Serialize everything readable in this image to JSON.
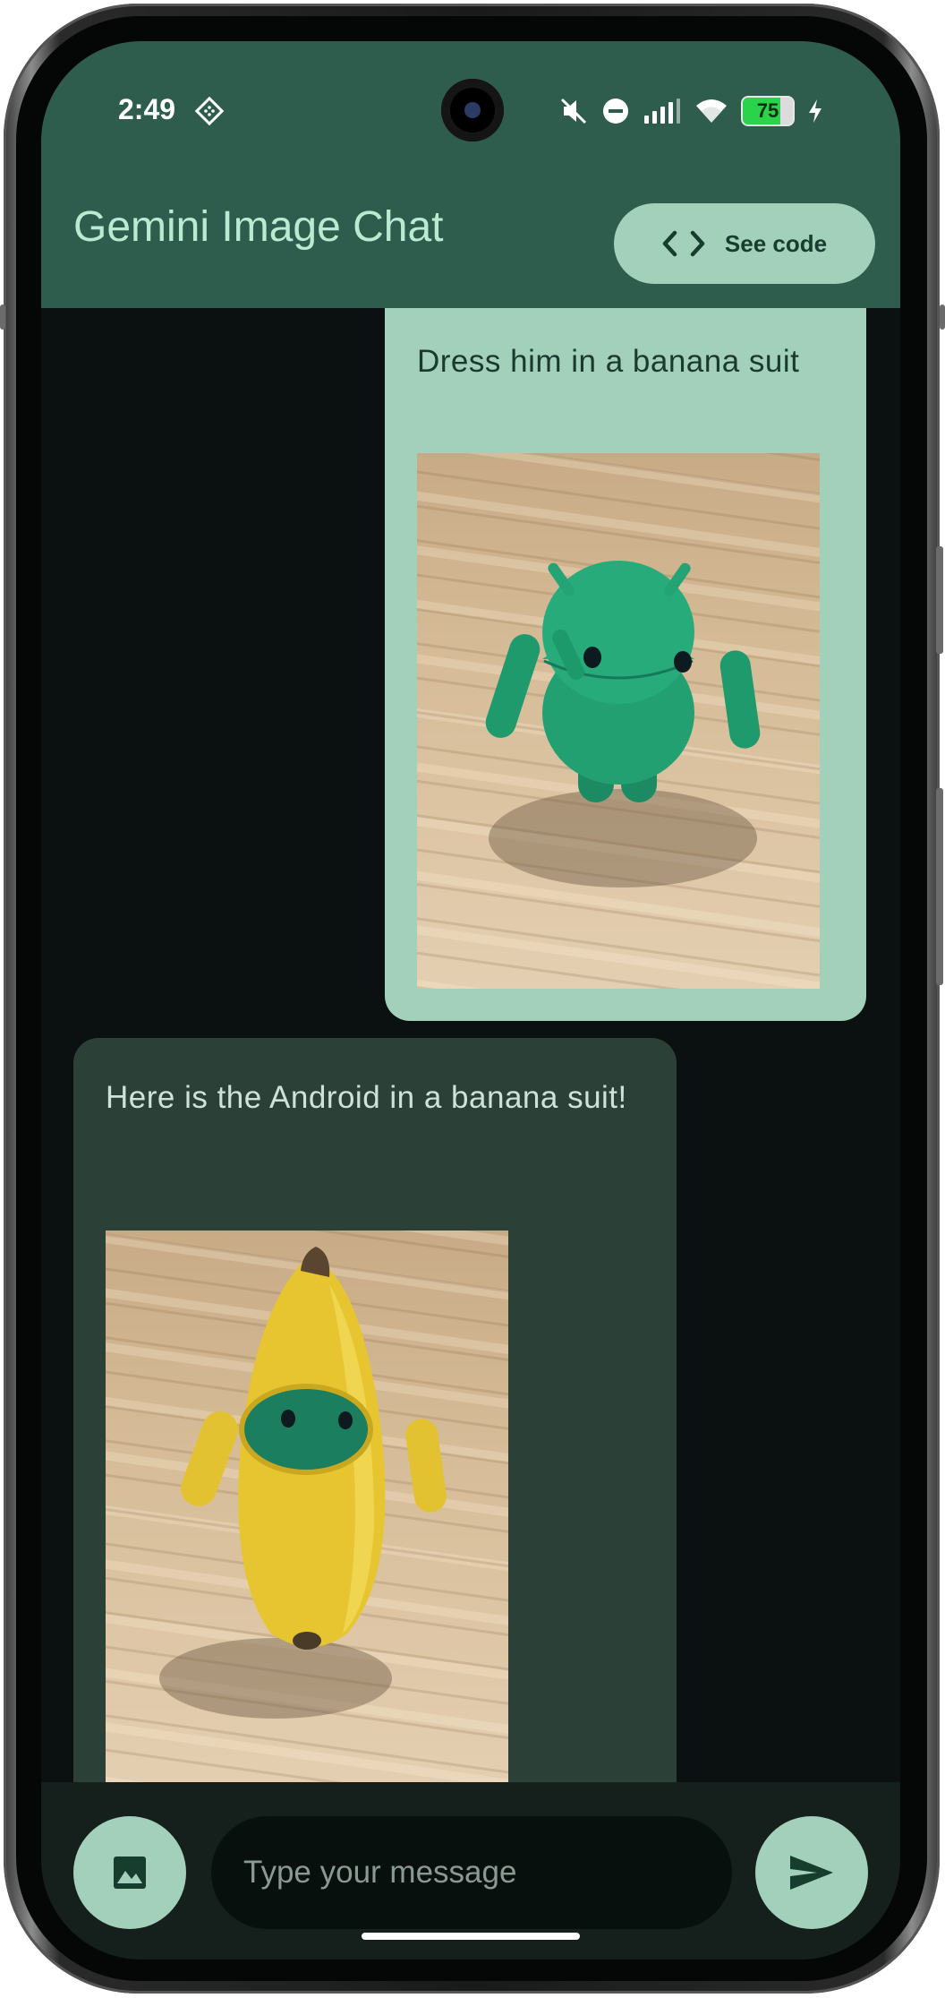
{
  "status_bar": {
    "time": "2:49",
    "battery_percent": "75",
    "icons": [
      "diamond-grid-icon",
      "mute-icon",
      "do-not-disturb-icon",
      "signal-icon",
      "wifi-icon",
      "battery-icon",
      "charging-icon"
    ]
  },
  "app_bar": {
    "title": "Gemini Image Chat",
    "see_code_label": "See code",
    "see_code_icon": "code-brackets-icon"
  },
  "messages": [
    {
      "role": "user",
      "text": "Dress him in a banana suit",
      "image": "green-android-figurine-photo"
    },
    {
      "role": "model",
      "text": "Here is the Android in a banana suit!",
      "image": "android-figurine-in-banana-suit-photo"
    }
  ],
  "composer": {
    "placeholder": "Type your message",
    "image_button_icon": "image-icon",
    "send_button_icon": "send-icon"
  },
  "colors": {
    "app_bar": "#2f5d4d",
    "title_text": "#b9ead2",
    "accent": "#a3d0bb",
    "background": "#0b1110",
    "model_bubble": "#2b4137",
    "bottom_bar": "#15201c"
  }
}
